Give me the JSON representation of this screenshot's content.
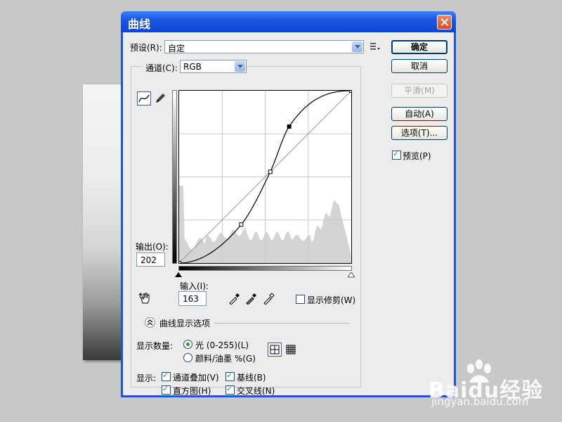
{
  "dialog": {
    "title": "曲线"
  },
  "preset": {
    "label": "预设(R):",
    "value": "自定"
  },
  "channel": {
    "label": "通道(C):",
    "value": "RGB"
  },
  "buttons": {
    "ok": "确定",
    "cancel": "取消",
    "smooth": "平滑(M)",
    "auto": "自动(A)",
    "options": "选项(T)..."
  },
  "preview": {
    "label": "预览(P)",
    "checked": true
  },
  "output": {
    "label": "输出(O):",
    "value": "202"
  },
  "input": {
    "label": "输入(I):",
    "value": "163"
  },
  "show_clipping": {
    "label": "显示修剪(W)",
    "checked": false
  },
  "curve_options": {
    "label": "曲线显示选项"
  },
  "show_amount": {
    "label": "显示数量:",
    "light": "光 (0-255)(L)",
    "pigment": "颜料/油墨 %(G)",
    "selected": "light"
  },
  "show": {
    "label": "显示:",
    "channel_overlays": "通道叠加(V)",
    "baseline": "基线(B)",
    "histogram": "直方图(H)",
    "intersection": "交叉线(N)"
  },
  "curve": {
    "points": [
      [
        0,
        0
      ],
      [
        92,
        57
      ],
      [
        135,
        135
      ],
      [
        163,
        202
      ],
      [
        255,
        255
      ]
    ]
  },
  "watermark": {
    "brand": "Baidu经验",
    "url": "jingyan.baidu.com"
  },
  "colors": {
    "title_bar": "#1f54d6",
    "face": "#ececec",
    "check": "#21a121"
  }
}
